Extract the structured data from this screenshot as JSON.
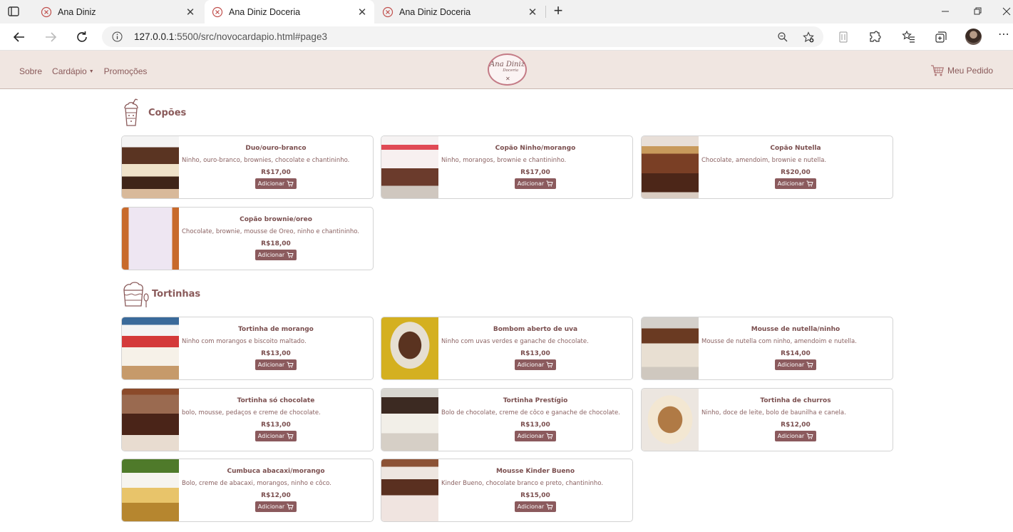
{
  "browser": {
    "tabs": [
      {
        "title": "Ana Diniz",
        "active": false
      },
      {
        "title": "Ana Diniz Doceria",
        "active": true
      },
      {
        "title": "Ana Diniz Doceria",
        "active": false
      }
    ],
    "url_host": "127.0.0.1",
    "url_rest": ":5500/src/novocardapio.html#page3"
  },
  "site": {
    "nav": [
      "Sobre",
      "Cardápio",
      "Promoções"
    ],
    "logo_line1": "Ana Diniz",
    "logo_line2": "Doceria",
    "order_label": "Meu Pedido"
  },
  "colors": {
    "brand": "#8b5a5d",
    "header_bg": "#f0e6e1",
    "text": "#7a4e4e"
  },
  "add_label": "Adicionar",
  "sections": [
    {
      "title": "Copões",
      "icon": "milkshake-cup-icon",
      "items": [
        {
          "name": "Duo/ouro-branco",
          "desc": "Ninho, ouro-branco, brownies, chocolate e chantininho.",
          "price": "R$17,00"
        },
        {
          "name": "Copão Ninho/morango",
          "desc": "Ninho, morangos, brownie e chantininho.",
          "price": "R$17,00"
        },
        {
          "name": "Copão Nutella",
          "desc": "Chocolate, amendoim, brownie e nutella.",
          "price": "R$20,00"
        },
        {
          "name": "Copão brownie/oreo",
          "desc": "Chocolate, brownie, mousse de Oreo, ninho e chantininho.",
          "price": "R$18,00"
        }
      ]
    },
    {
      "title": "Tortinhas",
      "icon": "tart-cup-icon",
      "items": [
        {
          "name": "Tortinha de morango",
          "desc": "Ninho com morangos e biscoito maltado.",
          "price": "R$13,00"
        },
        {
          "name": "Bombom aberto de uva",
          "desc": "Ninho com uvas verdes e ganache de chocolate.",
          "price": "R$13,00"
        },
        {
          "name": "Mousse de nutella/ninho",
          "desc": "Mousse de nutella com ninho, amendoim e nutella.",
          "price": "R$14,00"
        },
        {
          "name": "Tortinha só chocolate",
          "desc": "bolo, mousse, pedaços e creme de chocolate.",
          "price": "R$13,00"
        },
        {
          "name": "Tortinha Prestígio",
          "desc": "Bolo de chocolate, creme de côco e ganache de chocolate.",
          "price": "R$13,00"
        },
        {
          "name": "Tortinha de churros",
          "desc": "Ninho, doce de leite, bolo de baunilha e canela.",
          "price": "R$12,00"
        },
        {
          "name": "Cumbuca abacaxi/morango",
          "desc": "Bolo, creme de abacaxi, morangos, ninho e côco.",
          "price": "R$12,00"
        },
        {
          "name": "Mousse Kinder Bueno",
          "desc": "Kinder Bueno, chocolate branco e preto, chantininho.",
          "price": "R$15,00"
        }
      ]
    }
  ]
}
